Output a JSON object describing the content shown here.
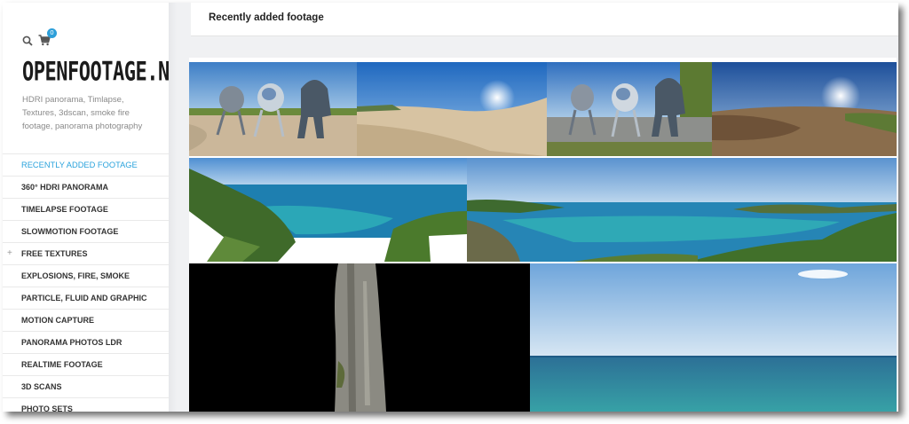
{
  "header": {
    "cart_count": "0",
    "logo_text": "OPENFOOTAGE.NET",
    "tagline": "HDRI panorama, Timlapse, Textures, 3dscan, smoke fire footage, panorama photography"
  },
  "icons": {
    "search": "search-icon",
    "cart": "cart-icon",
    "expand": "plus-icon"
  },
  "nav": {
    "items": [
      {
        "label": "RECENTLY ADDED FOOTAGE",
        "active": true
      },
      {
        "label": "360° HDRI PANORAMA"
      },
      {
        "label": "TIMELAPSE FOOTAGE"
      },
      {
        "label": "SLOWMOTION FOOTAGE"
      },
      {
        "label": "FREE TEXTURES",
        "expandable": true
      },
      {
        "label": "EXPLOSIONS, FIRE, SMOKE"
      },
      {
        "label": "PARTICLE, FLUID AND GRAPHIC"
      },
      {
        "label": "MOTION CAPTURE"
      },
      {
        "label": "PANORAMA PHOTOS LDR"
      },
      {
        "label": "REALTIME FOOTAGE"
      },
      {
        "label": "3D SCANS"
      },
      {
        "label": "PHOTO SETS"
      }
    ],
    "expand_symbol": "+"
  },
  "main": {
    "title": "Recently added footage",
    "gallery_items": [
      "hdri-beach-robots-thumbnail",
      "hdri-beach-panorama-thumbnail",
      "hdri-road-robots-thumbnail",
      "hdri-field-panorama-thumbnail",
      "coast-panorama-thumbnail",
      "bay-panorama-thumbnail",
      "tree-trunk-scan-thumbnail",
      "sea-horizon-thumbnail"
    ]
  },
  "colors": {
    "accent": "#2aa3dc",
    "badge": "#2d9fd9",
    "text_dark": "#333333",
    "text_muted": "#8a8a8a",
    "background": "#f0f1f3"
  }
}
